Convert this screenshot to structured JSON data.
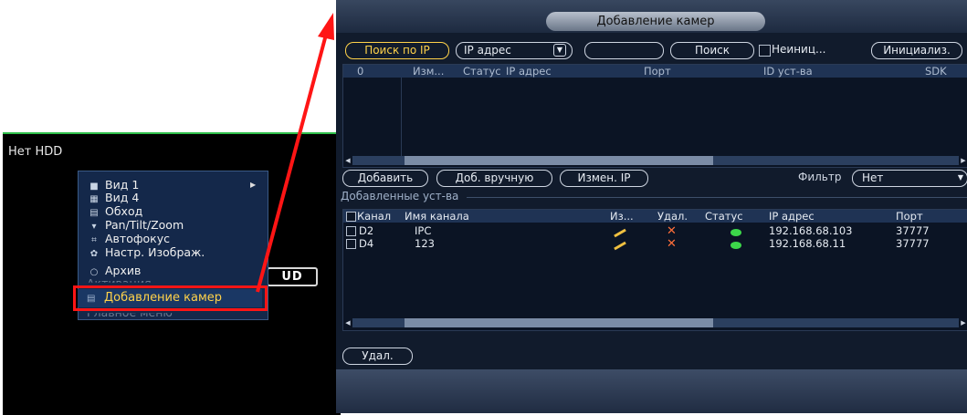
{
  "background": {
    "status": "Нет HDD",
    "logo": "UD"
  },
  "context_menu": {
    "items": [
      {
        "label": "Вид 1",
        "icon": "grid-1-icon",
        "submenu": true
      },
      {
        "label": "Вид 4",
        "icon": "grid-4-icon",
        "submenu": false
      },
      {
        "label": "Обход",
        "icon": "tour-icon",
        "submenu": false
      },
      {
        "label": "Pan/Tilt/Zoom",
        "icon": "ptz-icon",
        "submenu": false
      },
      {
        "label": "Автофокус",
        "icon": "autofocus-icon",
        "submenu": false
      },
      {
        "label": "Настр. Изображ.",
        "icon": "image-settings-icon",
        "submenu": false
      },
      {
        "label": "Архив",
        "icon": "search-icon",
        "submenu": false
      },
      {
        "label": "Активация",
        "icon": "activation-icon",
        "submenu": true
      }
    ],
    "selected": "Добавление камер",
    "partially_hidden": "Главное меню"
  },
  "dialog": {
    "title": "Добавление камер",
    "search_ip_button": "Поиск по IP",
    "protocol_select": "IP адрес",
    "search_field": "",
    "search_button": "Поиск",
    "uninit_label": "Неиниц...",
    "init_button": "Инициализ.",
    "found_headers": [
      "0",
      "Изм...",
      "Статус",
      "IP адрес",
      "Порт",
      "ID уст-ва",
      "SDK"
    ],
    "add_button": "Добавить",
    "manual_add_button": "Доб. вручную",
    "change_ip_button": "Измен. IP",
    "filter_label": "Фильтр",
    "filter_value": "Нет",
    "added_section_label": "Добавленные уст-ва",
    "added_headers": [
      "Канал",
      "Имя канала",
      "Из...",
      "Удал.",
      "Статус",
      "IP адрес",
      "Порт"
    ],
    "added_rows": [
      {
        "channel": "D2",
        "name": "IPC",
        "ip": "192.168.68.103",
        "port": "37777"
      },
      {
        "channel": "D4",
        "name": "123",
        "ip": "192.168.68.11",
        "port": "37777"
      }
    ],
    "delete_button": "Удал.",
    "colors": {
      "accent": "#ffd24a",
      "highlight": "#ff1515",
      "status_ok": "#3cd64a"
    }
  }
}
